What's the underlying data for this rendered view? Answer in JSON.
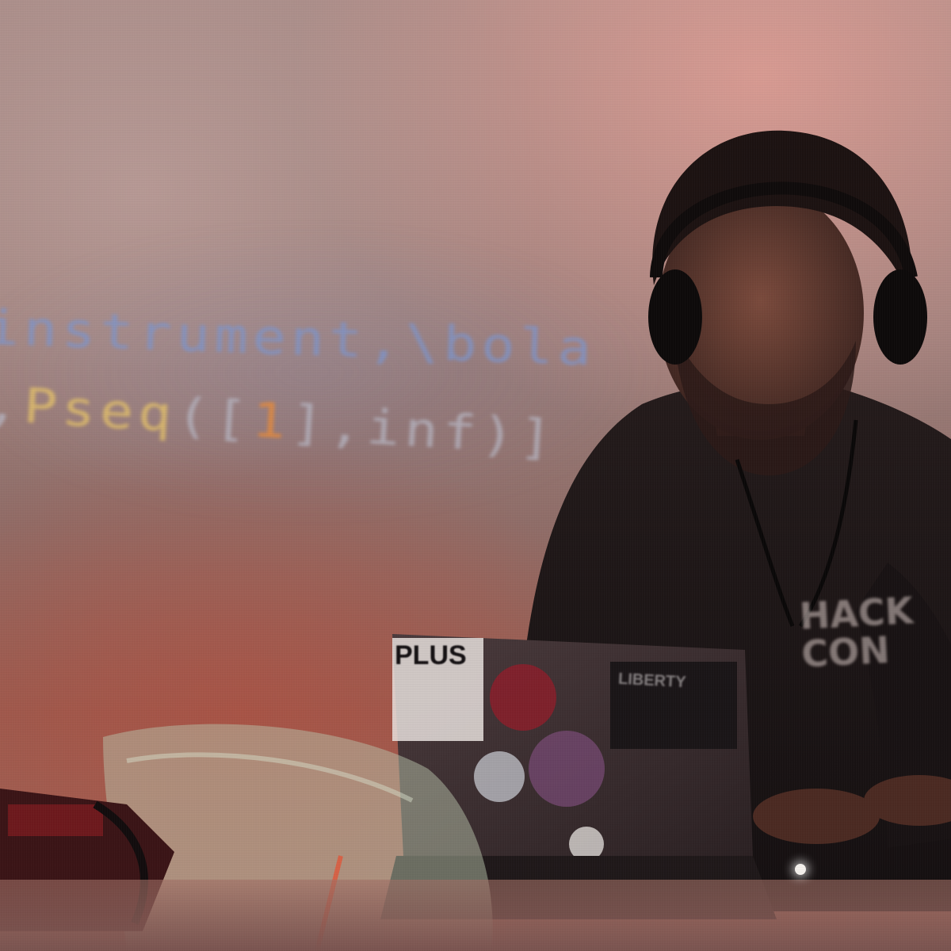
{
  "projection": {
    "line1": "instrument,\\bola",
    "line2_prefix": ",",
    "line2_func": "Pseq",
    "line2_open": "([",
    "line2_num": "1",
    "line2_rest": "],inf)]"
  },
  "laptop": {
    "sticker_main": "PLUS",
    "sticker_small": "LIBERTY"
  },
  "shirt": {
    "line1": "HACK",
    "line2": "CON"
  },
  "colors": {
    "wall_light": "#a78a86",
    "wall_red": "#c0786a",
    "code_blue": "#7f94c8",
    "code_gold": "#e3c06a",
    "code_orange": "#e58a3c",
    "shirt": "#1a1414"
  }
}
